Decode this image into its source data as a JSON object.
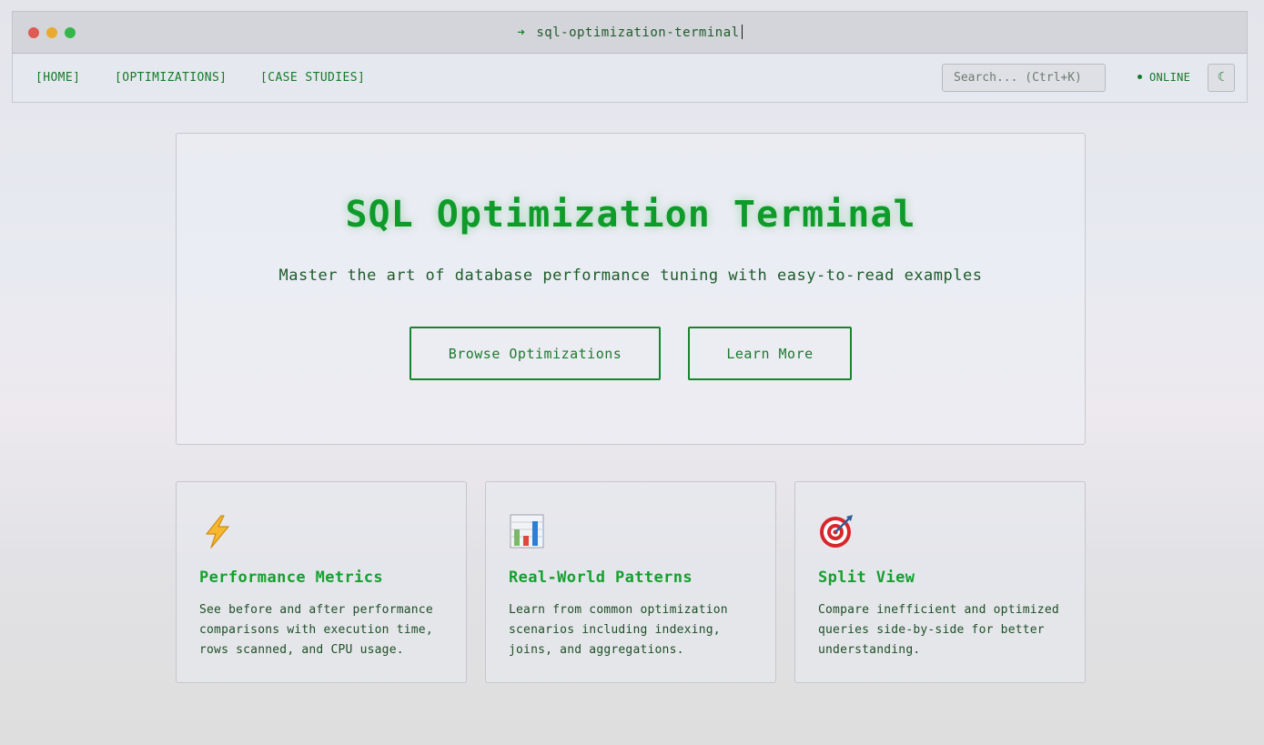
{
  "window": {
    "title_arrow": "➜",
    "title": "sql-optimization-terminal"
  },
  "nav": {
    "links": [
      "[HOME]",
      "[OPTIMIZATIONS]",
      "[CASE STUDIES]"
    ],
    "search_placeholder": "Search... (Ctrl+K)",
    "status": "ONLINE",
    "theme_toggle_icon": "☾"
  },
  "hero": {
    "title": "SQL Optimization Terminal",
    "subtitle": "Master the art of database performance tuning with easy-to-read examples",
    "buttons": {
      "browse": "Browse Optimizations",
      "learn": "Learn More"
    }
  },
  "features": [
    {
      "icon": "lightning-icon",
      "title": "Performance Metrics",
      "description": "See before and after performance comparisons with execution time, rows scanned, and CPU usage."
    },
    {
      "icon": "bar-chart-icon",
      "title": "Real-World Patterns",
      "description": "Learn from common optimization scenarios including indexing, joins, and aggregations."
    },
    {
      "icon": "target-icon",
      "title": "Split View",
      "description": "Compare inefficient and optimized queries side-by-side for better understanding."
    }
  ],
  "colors": {
    "accent": "#0e9b2a",
    "text_green": "#157a2a",
    "window_red": "#e05a55",
    "window_yellow": "#e8aa30",
    "window_green": "#34b64a"
  }
}
